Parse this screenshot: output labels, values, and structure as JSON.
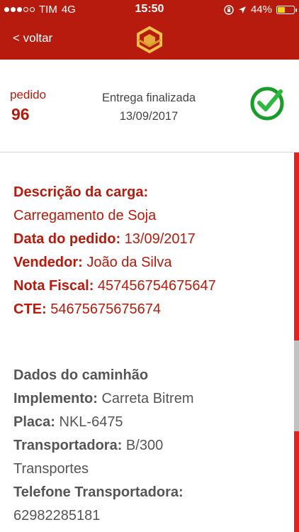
{
  "status_bar": {
    "carrier": "TIM",
    "network": "4G",
    "time": "15:50",
    "battery": "44%",
    "battery_level": 0.44,
    "signal_bars": 3
  },
  "nav": {
    "back_label": "< voltar",
    "logo_icon": "company-logo-icon",
    "bar_color": "#b61b0d"
  },
  "order": {
    "label": "pedido",
    "number": "96",
    "status": "Entrega finalizada",
    "date": "13/09/2017",
    "status_icon": "check-circle-icon"
  },
  "cargo": {
    "description_label": "Descrição da carga:",
    "description_value": "Carregamento de Soja",
    "date_label": "Data do pedido:",
    "date_value": "13/09/2017",
    "seller_label": "Vendedor:",
    "seller_value": "João da Silva",
    "invoice_label": "Nota Fiscal:",
    "invoice_value": "457456754675647",
    "cte_label": "CTE:",
    "cte_value": "54675675675674"
  },
  "truck": {
    "section_title": "Dados do caminhão",
    "implement_label": "Implemento:",
    "implement_value": "Carreta Bitrem",
    "plate_label": "Placa:",
    "plate_value": "NKL-6475",
    "carrier_label": "Transportadora:",
    "carrier_value_line1": "B/300",
    "carrier_value_line2": "Transportes",
    "phone_label": "Telefone Transportadora:",
    "phone_value": "62982285181"
  },
  "colors": {
    "accent": "#b61b0d",
    "success": "#1a9c2a",
    "scroll_track": "#e62117"
  }
}
